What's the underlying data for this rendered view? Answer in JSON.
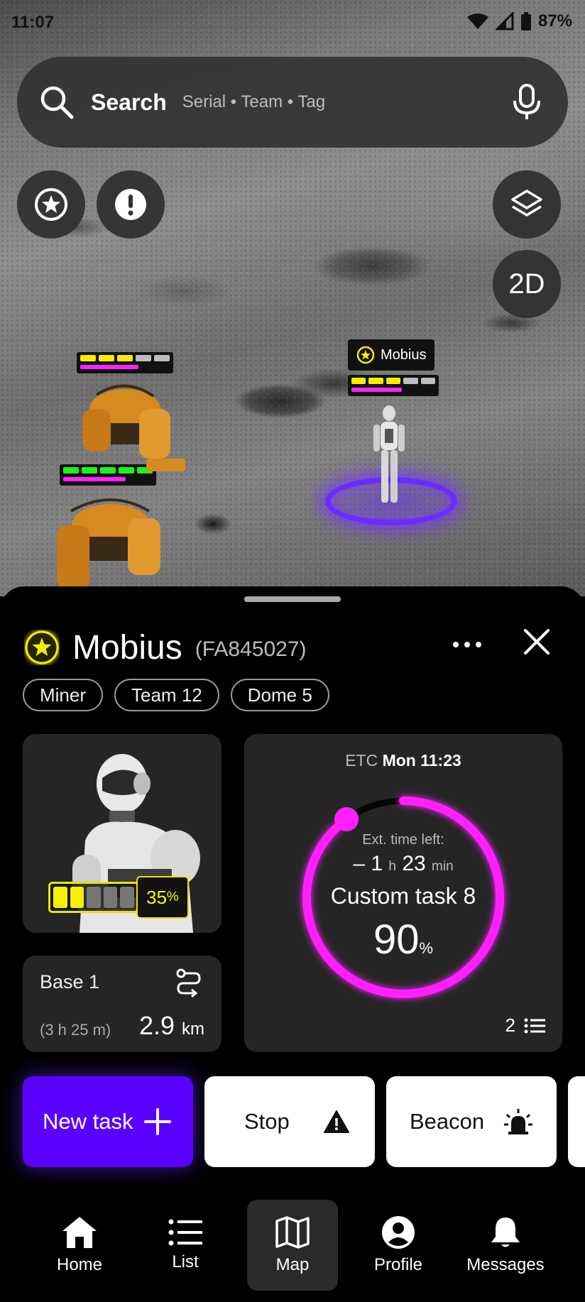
{
  "status_bar": {
    "time": "11:07",
    "battery": "87%"
  },
  "search": {
    "label": "Search",
    "placeholder": "Serial • Team • Tag"
  },
  "map": {
    "mode_button": "2D",
    "selected_label": "Mobius",
    "units": [
      {
        "name": "Mobius",
        "energy": 0.6,
        "segments": [
          "#f4ef00",
          "#f4ef00",
          "#f4ef00",
          "#bdbdbd",
          "#bdbdbd"
        ]
      },
      {
        "name": "",
        "energy": 0.65,
        "segments": [
          "#f4ef00",
          "#f4ef00",
          "#f4ef00",
          "#bdbdbd",
          "#bdbdbd"
        ]
      },
      {
        "name": "",
        "energy": 0.7,
        "segments": [
          "#1df21d",
          "#1df21d",
          "#1df21d",
          "#1df21d",
          "#1df21d"
        ]
      }
    ]
  },
  "robot": {
    "name": "Mobius",
    "serial": "(FA845027)",
    "tags": [
      "Miner",
      "Team 12",
      "Dome 5"
    ],
    "battery_pct": "35",
    "battery_unit": "%",
    "battery_cells": 5,
    "battery_filled": 2
  },
  "base": {
    "name": "Base 1",
    "eta": "(3 h 25 m)",
    "distance": "2.9",
    "distance_unit": "km"
  },
  "task": {
    "etc_label": "ETC",
    "etc_value": "Mon 11:23",
    "ext_label": "Ext. time left:",
    "ext_prefix": "– 1",
    "ext_h": "h",
    "ext_min_value": "23",
    "ext_min": "min",
    "name": "Custom task 8",
    "progress_pct": "90",
    "progress_unit": "%",
    "progress": 0.9,
    "queue_count": "2"
  },
  "actions": {
    "new_task": "New task",
    "stop": "Stop",
    "beacon": "Beacon"
  },
  "nav": [
    {
      "label": "Home",
      "icon": "home-icon"
    },
    {
      "label": "List",
      "icon": "list-icon"
    },
    {
      "label": "Map",
      "icon": "map-icon",
      "active": true
    },
    {
      "label": "Profile",
      "icon": "profile-icon"
    },
    {
      "label": "Messages",
      "icon": "bell-icon"
    }
  ],
  "colors": {
    "accent_purple": "#5a00ff",
    "progress_magenta": "#ff1fff",
    "battery_yellow": "#f4ef00",
    "sheet_bg": "#000000",
    "card_bg": "#252525"
  }
}
